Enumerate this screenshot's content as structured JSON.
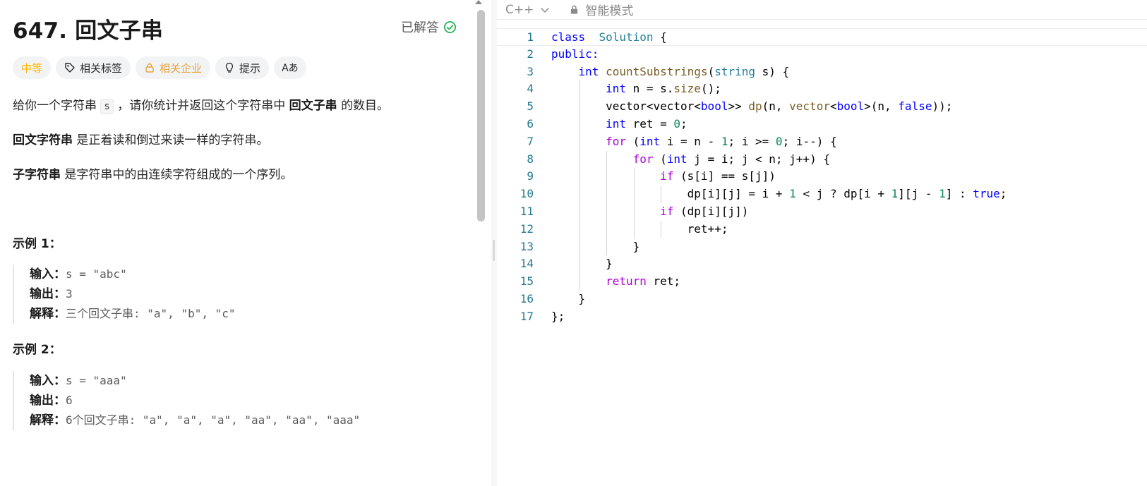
{
  "problem": {
    "title": "647. 回文子串",
    "solved_label": "已解答",
    "tags": {
      "difficulty": "中等",
      "related_tags": "相关标签",
      "related_companies": "相关企业",
      "hint": "提示",
      "translate": "Aあ"
    },
    "description": {
      "p1_before": "给你一个字符串",
      "p1_code": "s",
      "p1_middle": "，请你统计并返回这个字符串中",
      "p1_bold": "回文子串",
      "p1_after": "的数目。",
      "p2_bold": "回文字符串",
      "p2_after": "是正着读和倒过来读一样的字符串。",
      "p3_bold": "子字符串",
      "p3_after": "是字符串中的由连续字符组成的一个序列。"
    },
    "examples": [
      {
        "title": "示例 1：",
        "input_label": "输入：",
        "input_value": "s = \"abc\"",
        "output_label": "输出：",
        "output_value": "3",
        "explain_label": "解释：",
        "explain_value": "三个回文子串: \"a\", \"b\", \"c\""
      },
      {
        "title": "示例 2：",
        "input_label": "输入：",
        "input_value": "s = \"aaa\"",
        "output_label": "输出：",
        "output_value": "6",
        "explain_label": "解释：",
        "explain_value": "6个回文子串: \"a\", \"a\", \"a\", \"aa\", \"aa\", \"aaa\""
      }
    ]
  },
  "editor": {
    "language": "C++",
    "mode": "智能模式",
    "lines": [
      [
        [
          "kw",
          "class"
        ],
        [
          "",
          "  "
        ],
        [
          "ty",
          "Solution"
        ],
        [
          "",
          " {"
        ]
      ],
      [
        [
          "kw",
          "public:"
        ]
      ],
      [
        [
          "",
          "    "
        ],
        [
          "kw",
          "int"
        ],
        [
          "",
          " "
        ],
        [
          "fn",
          "countSubstrings"
        ],
        [
          "",
          "("
        ],
        [
          "ty",
          "string"
        ],
        [
          "",
          " s) {"
        ]
      ],
      [
        [
          "",
          "        "
        ],
        [
          "kw",
          "int"
        ],
        [
          "",
          " n = s."
        ],
        [
          "fn",
          "size"
        ],
        [
          "",
          "();"
        ]
      ],
      [
        [
          "",
          "        vector<vector<"
        ],
        [
          "kw",
          "bool"
        ],
        [
          "",
          ">> "
        ],
        [
          "fn",
          "dp"
        ],
        [
          "",
          "(n, "
        ],
        [
          "fn",
          "vector"
        ],
        [
          "",
          "<"
        ],
        [
          "kw",
          "bool"
        ],
        [
          "",
          ">(n, "
        ],
        [
          "kw",
          "false"
        ],
        [
          "",
          "));"
        ]
      ],
      [
        [
          "",
          "        "
        ],
        [
          "kw",
          "int"
        ],
        [
          "",
          " ret = "
        ],
        [
          "num",
          "0"
        ],
        [
          "",
          ";"
        ]
      ],
      [
        [
          "",
          "        "
        ],
        [
          "ctl",
          "for"
        ],
        [
          "",
          " ("
        ],
        [
          "kw",
          "int"
        ],
        [
          "",
          " i = n - "
        ],
        [
          "num",
          "1"
        ],
        [
          "",
          "; i >= "
        ],
        [
          "num",
          "0"
        ],
        [
          "",
          "; i--) {"
        ]
      ],
      [
        [
          "",
          "            "
        ],
        [
          "ctl",
          "for"
        ],
        [
          "",
          " ("
        ],
        [
          "kw",
          "int"
        ],
        [
          "",
          " j = i; j < n; j++) {"
        ]
      ],
      [
        [
          "",
          "                "
        ],
        [
          "ctl",
          "if"
        ],
        [
          "",
          " (s[i] == s[j])"
        ]
      ],
      [
        [
          "",
          "                    dp[i][j] = i + "
        ],
        [
          "num",
          "1"
        ],
        [
          "",
          " < j ? dp[i + "
        ],
        [
          "num",
          "1"
        ],
        [
          "",
          "][j - "
        ],
        [
          "num",
          "1"
        ],
        [
          "",
          "] : "
        ],
        [
          "kw",
          "true"
        ],
        [
          "",
          ";"
        ]
      ],
      [
        [
          "",
          "                "
        ],
        [
          "ctl",
          "if"
        ],
        [
          "",
          " (dp[i][j])"
        ]
      ],
      [
        [
          "",
          "                    ret++;"
        ]
      ],
      [
        [
          "",
          "            }"
        ]
      ],
      [
        [
          "",
          "        }"
        ]
      ],
      [
        [
          "",
          "        "
        ],
        [
          "ctl",
          "return"
        ],
        [
          "",
          " ret;"
        ]
      ],
      [
        [
          "",
          "    }"
        ]
      ],
      [
        [
          "",
          "};"
        ]
      ]
    ]
  }
}
